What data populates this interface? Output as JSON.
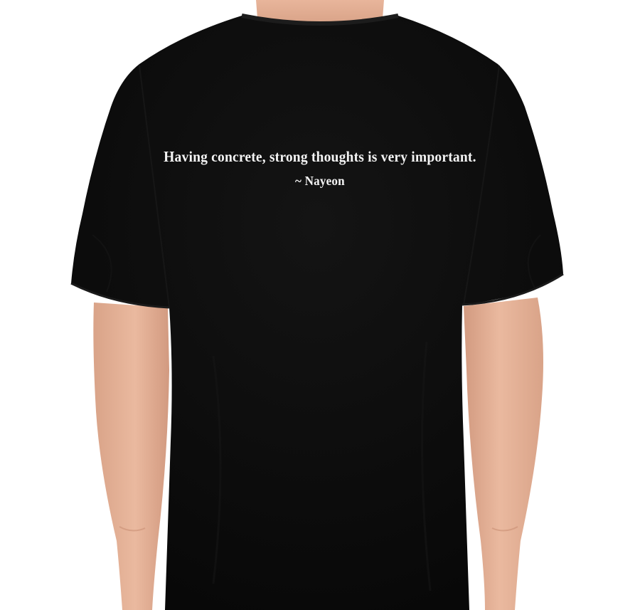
{
  "image": {
    "background_color": "#ffffff",
    "shirt_color": "#0f0f0f",
    "skin_color": "#e6b49c",
    "print_color": "#f4f4f4"
  },
  "shirt_print": {
    "quote": "Having concrete, strong thoughts is very important.",
    "attribution": "~ Nayeon"
  }
}
